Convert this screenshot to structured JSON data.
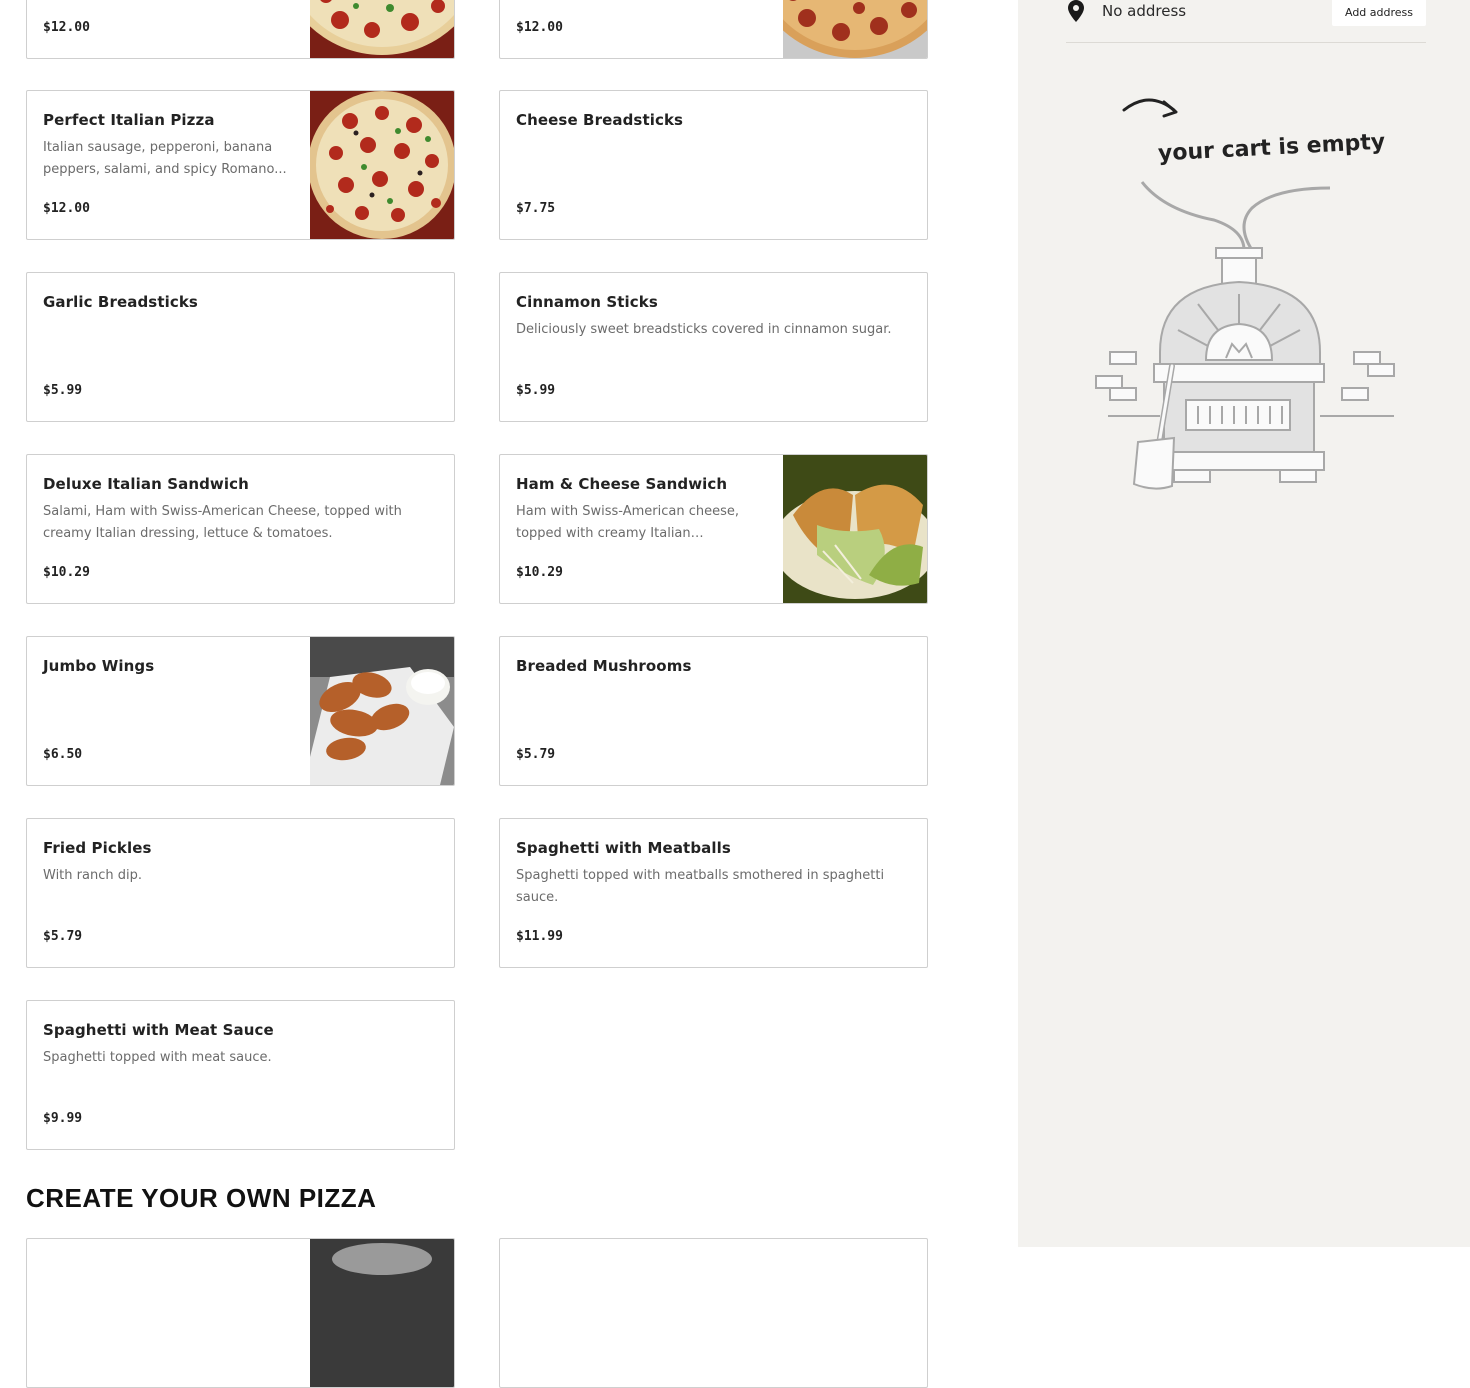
{
  "menu_items": [
    {
      "name": "",
      "description": "",
      "price": "$12.00",
      "image": "pizza-photo"
    },
    {
      "name": "",
      "description": "",
      "price": "$12.00",
      "image": "pizza-photo"
    },
    {
      "name": "Perfect Italian Pizza",
      "description": "Italian sausage, pepperoni, banana peppers, salami, and spicy Romano...",
      "price": "$12.00",
      "image": "pizza-photo"
    },
    {
      "name": "Cheese Breadsticks",
      "description": "",
      "price": "$7.75",
      "image": ""
    },
    {
      "name": "Garlic Breadsticks",
      "description": "",
      "price": "$5.99",
      "image": ""
    },
    {
      "name": "Cinnamon Sticks",
      "description": "Deliciously sweet breadsticks covered in cinnamon sugar.",
      "price": "$5.99",
      "image": ""
    },
    {
      "name": "Deluxe Italian Sandwich",
      "description": "Salami, Ham with Swiss-American Cheese, topped with creamy Italian dressing, lettuce & tomatoes.",
      "price": "$10.29",
      "image": ""
    },
    {
      "name": "Ham & Cheese Sandwich",
      "description": "Ham with Swiss-American cheese, topped with creamy Italian dressing,...",
      "price": "$10.29",
      "image": "sandwich-photo"
    },
    {
      "name": "Jumbo Wings",
      "description": "",
      "price": "$6.50",
      "image": "wings-photo"
    },
    {
      "name": "Breaded Mushrooms",
      "description": "",
      "price": "$5.79",
      "image": ""
    },
    {
      "name": "Fried Pickles",
      "description": "With ranch dip.",
      "price": "$5.79",
      "image": ""
    },
    {
      "name": "Spaghetti with Meatballs",
      "description": "Spaghetti topped with meatballs smothered in spaghetti sauce.",
      "price": "$11.99",
      "image": ""
    },
    {
      "name": "Spaghetti with Meat Sauce",
      "description": "Spaghetti topped with meat sauce.",
      "price": "$9.99",
      "image": ""
    }
  ],
  "section": {
    "title": "CREATE YOUR OWN PIZZA"
  },
  "sidebar": {
    "address_text": "No address",
    "add_address_label": "Add address",
    "address_icon": "map-pin-icon",
    "empty_cart_text": "your cart is empty",
    "illustration": "pizza-oven-illustration"
  },
  "colors": {
    "sidebar_bg": "#f3f2ef",
    "card_border": "#cfcfcf",
    "desc_text": "#6b6b6b"
  }
}
